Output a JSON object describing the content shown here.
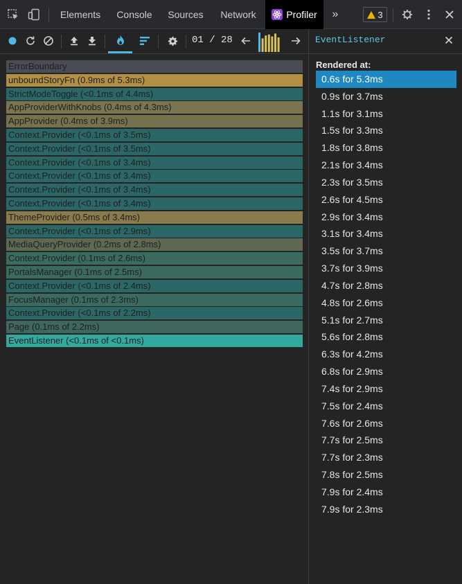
{
  "devtools": {
    "tabs": [
      "Elements",
      "Console",
      "Sources",
      "Network",
      "Profiler"
    ],
    "active_tab": "Profiler",
    "warnings_count": "3"
  },
  "toolbar": {
    "commit_counter": "01 / 28",
    "commit_bar_heights": [
      1.0,
      0.7,
      0.85,
      0.9,
      0.8,
      0.95,
      0.75
    ]
  },
  "flamegraph": {
    "rows": [
      {
        "label": "ErrorBoundary",
        "color": "#4a4d55",
        "width": 1.0
      },
      {
        "label": "unboundStoryFn (0.9ms of 5.3ms)",
        "color": "#b38f45",
        "width": 1.0
      },
      {
        "label": "StrictModeToggle (<0.1ms of 4.4ms)",
        "color": "#2b6767",
        "width": 1.0
      },
      {
        "label": "AppProviderWithKnobs (0.4ms of 4.3ms)",
        "color": "#7a7550",
        "width": 1.0
      },
      {
        "label": "AppProvider (0.4ms of 3.9ms)",
        "color": "#75734f",
        "width": 1.0
      },
      {
        "label": "Context.Provider (<0.1ms of 3.5ms)",
        "color": "#2b6767",
        "width": 1.0
      },
      {
        "label": "Context.Provider (<0.1ms of 3.5ms)",
        "color": "#2b6767",
        "width": 1.0
      },
      {
        "label": "Context.Provider (<0.1ms of 3.4ms)",
        "color": "#2b6767",
        "width": 1.0
      },
      {
        "label": "Context.Provider (<0.1ms of 3.4ms)",
        "color": "#2b6767",
        "width": 1.0
      },
      {
        "label": "Context.Provider (<0.1ms of 3.4ms)",
        "color": "#2b6767",
        "width": 1.0
      },
      {
        "label": "Context.Provider (<0.1ms of 3.4ms)",
        "color": "#2b6767",
        "width": 1.0
      },
      {
        "label": "ThemeProvider (0.5ms of 3.4ms)",
        "color": "#8a7b4c",
        "width": 1.0
      },
      {
        "label": "Context.Provider (<0.1ms of 2.9ms)",
        "color": "#2b6767",
        "width": 1.0
      },
      {
        "label": "MediaQueryProvider (0.2ms of 2.8ms)",
        "color": "#5d6953",
        "width": 1.0
      },
      {
        "label": "Context.Provider (0.1ms of 2.6ms)",
        "color": "#3b6a5f",
        "width": 1.0
      },
      {
        "label": "PortalsManager (0.1ms of 2.5ms)",
        "color": "#3b6a5f",
        "width": 1.0
      },
      {
        "label": "Context.Provider (<0.1ms of 2.4ms)",
        "color": "#2b6767",
        "width": 1.0
      },
      {
        "label": "FocusManager (0.1ms of 2.3ms)",
        "color": "#3b6a5f",
        "width": 1.0
      },
      {
        "label": "Context.Provider (<0.1ms of 2.2ms)",
        "color": "#2b6767",
        "width": 1.0
      },
      {
        "label": "Page (0.1ms of 2.2ms)",
        "color": "#3f6760",
        "width": 1.0
      },
      {
        "label": "EventListener (<0.1ms of <0.1ms)",
        "color": "#33a89f",
        "width": 1.0
      }
    ]
  },
  "sidebar": {
    "title": "EventListener",
    "rendered_at_label": "Rendered at:",
    "renders": [
      "0.6s for 5.3ms",
      "0.9s for 3.7ms",
      "1.1s for 3.1ms",
      "1.5s for 3.3ms",
      "1.8s for 3.8ms",
      "2.1s for 3.4ms",
      "2.3s for 3.5ms",
      "2.6s for 4.5ms",
      "2.9s for 3.4ms",
      "3.1s for 3.4ms",
      "3.5s for 3.7ms",
      "3.7s for 3.9ms",
      "4.7s for 2.8ms",
      "4.8s for 2.6ms",
      "5.1s for 2.7ms",
      "5.6s for 2.8ms",
      "6.3s for 4.2ms",
      "6.8s for 2.9ms",
      "7.4s for 2.9ms",
      "7.5s for 2.4ms",
      "7.6s for 2.6ms",
      "7.7s for 2.5ms",
      "7.7s for 2.3ms",
      "7.8s for 2.5ms",
      "7.9s for 2.4ms",
      "7.9s for 2.3ms"
    ],
    "selected_index": 0
  }
}
